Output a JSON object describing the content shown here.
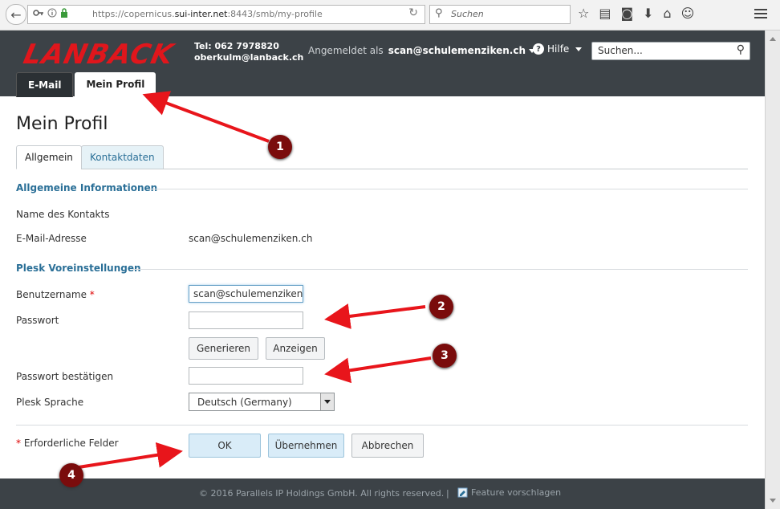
{
  "browser": {
    "url_prefix": "https://copernicus.",
    "url_host": "sui-inter.net",
    "url_rest": ":8443/smb/my-profile",
    "search_placeholder": "Suchen"
  },
  "header": {
    "logo_text": "LANBACK",
    "phone": "Tel: 062 7978820",
    "email": "oberkulm@lanback.ch",
    "logged_in_label": "Angemeldet als",
    "logged_in_user": "scan@schulemenziken.ch",
    "help_label": "Hilfe",
    "search_placeholder": "Suchen..."
  },
  "main_tabs": [
    {
      "label": "E-Mail"
    },
    {
      "label": "Mein Profil"
    }
  ],
  "page": {
    "title": "Mein Profil",
    "subtabs": [
      {
        "label": "Allgemein"
      },
      {
        "label": "Kontaktdaten"
      }
    ]
  },
  "general_info": {
    "section_title": "Allgemeine Informationen",
    "contact_name_label": "Name des Kontakts",
    "email_label": "E-Mail-Adresse",
    "email_value": "scan@schulemenziken.ch"
  },
  "plesk": {
    "section_title": "Plesk Voreinstellungen",
    "username_label": "Benutzername",
    "required_mark": "*",
    "username_value": "scan@schulemenziken.",
    "password_label": "Passwort",
    "password_value": "",
    "generate_label": "Generieren",
    "show_label": "Anzeigen",
    "confirm_label": "Passwort bestätigen",
    "confirm_value": "",
    "language_label": "Plesk Sprache",
    "language_value": "Deutsch (Germany)"
  },
  "form_footer": {
    "required_note": "Erforderliche Felder",
    "ok_label": "OK",
    "apply_label": "Übernehmen",
    "cancel_label": "Abbrechen"
  },
  "footer": {
    "copyright": "© 2016 Parallels IP Holdings GmbH. All rights reserved.",
    "separator": "|",
    "feature_link": "Feature vorschlagen"
  },
  "annotations": {
    "markers": [
      "1",
      "2",
      "3",
      "4"
    ],
    "color": "#e8151b"
  }
}
